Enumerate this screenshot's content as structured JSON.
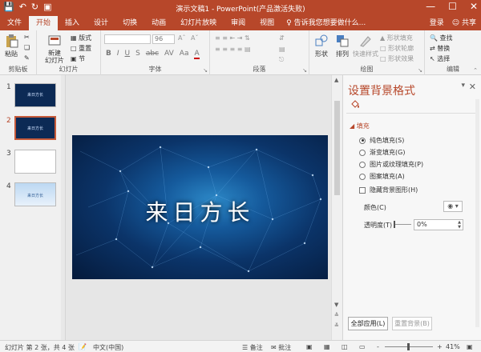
{
  "window": {
    "title": "演示文稿1 - PowerPoint(产品激活失败)",
    "controls": [
      "—",
      "☐",
      "✕"
    ],
    "qat_icons": [
      "save-icon",
      "undo-icon",
      "redo-icon",
      "slideshow-icon"
    ]
  },
  "ribbon_tabs": [
    "文件",
    "开始",
    "插入",
    "设计",
    "切换",
    "动画",
    "幻灯片放映",
    "审阅",
    "视图"
  ],
  "active_tab": "开始",
  "tell_me": "♀ 告诉我您想要做什么...",
  "account": {
    "login": "登录",
    "share": "共享"
  },
  "ribbon": {
    "clipboard": {
      "paste": "粘贴",
      "label": "剪贴板"
    },
    "slides": {
      "new_slide": "新建\n幻灯片",
      "layout": "版式",
      "reset": "重置",
      "section": "节",
      "label": "幻灯片"
    },
    "font": {
      "size": "96",
      "format_buttons": [
        "B",
        "I",
        "U",
        "S",
        "abc",
        "AV",
        "Aa",
        "A"
      ],
      "label": "字体"
    },
    "paragraph": {
      "label": "段落"
    },
    "drawing": {
      "shapes": "形状",
      "arrange": "排列",
      "quick_styles": "快速样式",
      "fill": "形状填充",
      "outline": "形状轮廓",
      "effects": "形状效果",
      "label": "绘图"
    },
    "editing": {
      "find": "查找",
      "replace": "替换",
      "select": "选择",
      "label": "编辑"
    }
  },
  "thumbnails": [
    {
      "num": "1",
      "title": "来日方长"
    },
    {
      "num": "2",
      "title": "来日方长"
    },
    {
      "num": "3",
      "title": ""
    },
    {
      "num": "4",
      "title": "来日方长"
    }
  ],
  "selected_slide": 2,
  "slide": {
    "title": "来日方长"
  },
  "format_pane": {
    "title": "设置背景格式",
    "section": "填充",
    "options": [
      "纯色填充(S)",
      "渐变填充(G)",
      "图片或纹理填充(P)",
      "图案填充(A)"
    ],
    "selected_option": 0,
    "hide_graphics": "隐藏背景图形(H)",
    "color_label": "颜色(C)",
    "transparency_label": "透明度(T)",
    "transparency_value": "0%",
    "apply_all": "全部应用(L)",
    "reset": "重置背景(B)"
  },
  "status": {
    "slide_info": "幻灯片 第 2 张，共 4 张",
    "language": "中文(中国)",
    "notes": "备注",
    "comments": "批注",
    "zoom_minus": "-",
    "zoom_plus": "+",
    "zoom": "41%"
  },
  "colors": {
    "accent": "#b7472a",
    "ribbon_bg": "#f3f3f3"
  }
}
